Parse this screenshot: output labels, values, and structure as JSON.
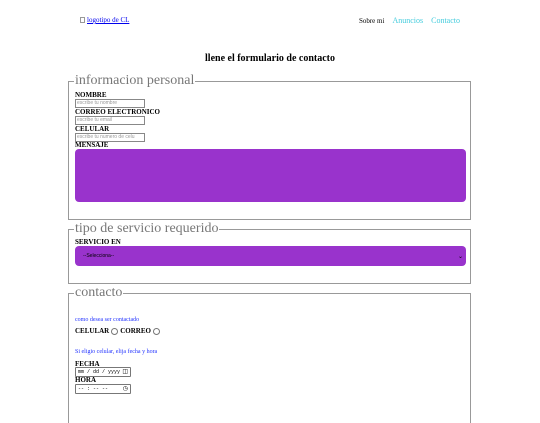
{
  "header": {
    "logo_alt": "logotipo de CL",
    "nav_text": "Sobre mi",
    "nav_links": [
      "Anuncios",
      "Contacto"
    ]
  },
  "page_title": "llene el formulario de contacto",
  "personal": {
    "legend": "informacion personal",
    "name_label": "NOMBRE",
    "name_placeholder": "escribe tu nombre",
    "email_label": "CORREO ELECTRONICO",
    "email_placeholder": "escribe tu email",
    "phone_label": "CELULAR",
    "phone_placeholder": "escribe tu numero de celu",
    "message_label": "MENSAJE"
  },
  "service": {
    "legend": "tipo de servicio requerido",
    "label": "SERVICIO EN",
    "selected": "--Selecciona--"
  },
  "contact": {
    "legend": "contacto",
    "prompt": "como desea ser contactado",
    "option_phone": "CELULAR",
    "option_email": "CORREO",
    "phone_note": "Si eligio celular, elija fecha y hora",
    "date_label": "FECHA",
    "date_placeholder": "mm / dd / yyyy",
    "time_label": "HORA",
    "time_placeholder": "-- : -- --"
  },
  "colors": {
    "accent": "#9933cc",
    "nav_link": "#44ccdd",
    "note": "#2233ff"
  },
  "icons": {
    "calendar": "calendar-icon",
    "clock": "clock-icon"
  }
}
